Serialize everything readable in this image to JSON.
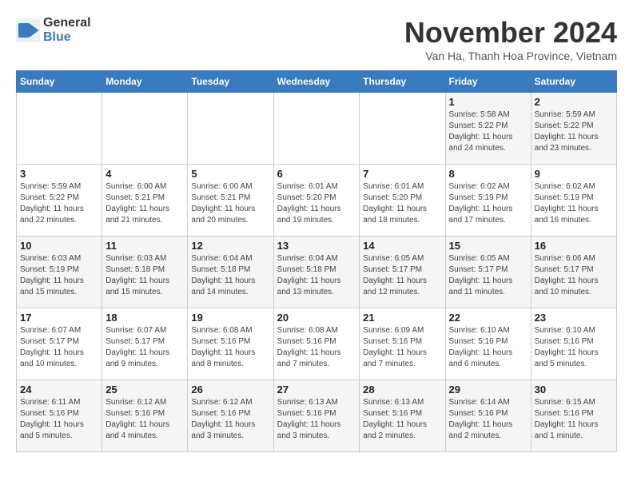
{
  "header": {
    "logo_line1": "General",
    "logo_line2": "Blue",
    "month_title": "November 2024",
    "location": "Van Ha, Thanh Hoa Province, Vietnam"
  },
  "weekdays": [
    "Sunday",
    "Monday",
    "Tuesday",
    "Wednesday",
    "Thursday",
    "Friday",
    "Saturday"
  ],
  "weeks": [
    {
      "cells": [
        {
          "day": "",
          "info": ""
        },
        {
          "day": "",
          "info": ""
        },
        {
          "day": "",
          "info": ""
        },
        {
          "day": "",
          "info": ""
        },
        {
          "day": "",
          "info": ""
        },
        {
          "day": "1",
          "info": "Sunrise: 5:58 AM\nSunset: 5:22 PM\nDaylight: 11 hours\nand 24 minutes."
        },
        {
          "day": "2",
          "info": "Sunrise: 5:59 AM\nSunset: 5:22 PM\nDaylight: 11 hours\nand 23 minutes."
        }
      ]
    },
    {
      "cells": [
        {
          "day": "3",
          "info": "Sunrise: 5:59 AM\nSunset: 5:22 PM\nDaylight: 11 hours\nand 22 minutes."
        },
        {
          "day": "4",
          "info": "Sunrise: 6:00 AM\nSunset: 5:21 PM\nDaylight: 11 hours\nand 21 minutes."
        },
        {
          "day": "5",
          "info": "Sunrise: 6:00 AM\nSunset: 5:21 PM\nDaylight: 11 hours\nand 20 minutes."
        },
        {
          "day": "6",
          "info": "Sunrise: 6:01 AM\nSunset: 5:20 PM\nDaylight: 11 hours\nand 19 minutes."
        },
        {
          "day": "7",
          "info": "Sunrise: 6:01 AM\nSunset: 5:20 PM\nDaylight: 11 hours\nand 18 minutes."
        },
        {
          "day": "8",
          "info": "Sunrise: 6:02 AM\nSunset: 5:19 PM\nDaylight: 11 hours\nand 17 minutes."
        },
        {
          "day": "9",
          "info": "Sunrise: 6:02 AM\nSunset: 5:19 PM\nDaylight: 11 hours\nand 16 minutes."
        }
      ]
    },
    {
      "cells": [
        {
          "day": "10",
          "info": "Sunrise: 6:03 AM\nSunset: 5:19 PM\nDaylight: 11 hours\nand 15 minutes."
        },
        {
          "day": "11",
          "info": "Sunrise: 6:03 AM\nSunset: 5:18 PM\nDaylight: 11 hours\nand 15 minutes."
        },
        {
          "day": "12",
          "info": "Sunrise: 6:04 AM\nSunset: 5:18 PM\nDaylight: 11 hours\nand 14 minutes."
        },
        {
          "day": "13",
          "info": "Sunrise: 6:04 AM\nSunset: 5:18 PM\nDaylight: 11 hours\nand 13 minutes."
        },
        {
          "day": "14",
          "info": "Sunrise: 6:05 AM\nSunset: 5:17 PM\nDaylight: 11 hours\nand 12 minutes."
        },
        {
          "day": "15",
          "info": "Sunrise: 6:05 AM\nSunset: 5:17 PM\nDaylight: 11 hours\nand 11 minutes."
        },
        {
          "day": "16",
          "info": "Sunrise: 6:06 AM\nSunset: 5:17 PM\nDaylight: 11 hours\nand 10 minutes."
        }
      ]
    },
    {
      "cells": [
        {
          "day": "17",
          "info": "Sunrise: 6:07 AM\nSunset: 5:17 PM\nDaylight: 11 hours\nand 10 minutes."
        },
        {
          "day": "18",
          "info": "Sunrise: 6:07 AM\nSunset: 5:17 PM\nDaylight: 11 hours\nand 9 minutes."
        },
        {
          "day": "19",
          "info": "Sunrise: 6:08 AM\nSunset: 5:16 PM\nDaylight: 11 hours\nand 8 minutes."
        },
        {
          "day": "20",
          "info": "Sunrise: 6:08 AM\nSunset: 5:16 PM\nDaylight: 11 hours\nand 7 minutes."
        },
        {
          "day": "21",
          "info": "Sunrise: 6:09 AM\nSunset: 5:16 PM\nDaylight: 11 hours\nand 7 minutes."
        },
        {
          "day": "22",
          "info": "Sunrise: 6:10 AM\nSunset: 5:16 PM\nDaylight: 11 hours\nand 6 minutes."
        },
        {
          "day": "23",
          "info": "Sunrise: 6:10 AM\nSunset: 5:16 PM\nDaylight: 11 hours\nand 5 minutes."
        }
      ]
    },
    {
      "cells": [
        {
          "day": "24",
          "info": "Sunrise: 6:11 AM\nSunset: 5:16 PM\nDaylight: 11 hours\nand 5 minutes."
        },
        {
          "day": "25",
          "info": "Sunrise: 6:12 AM\nSunset: 5:16 PM\nDaylight: 11 hours\nand 4 minutes."
        },
        {
          "day": "26",
          "info": "Sunrise: 6:12 AM\nSunset: 5:16 PM\nDaylight: 11 hours\nand 3 minutes."
        },
        {
          "day": "27",
          "info": "Sunrise: 6:13 AM\nSunset: 5:16 PM\nDaylight: 11 hours\nand 3 minutes."
        },
        {
          "day": "28",
          "info": "Sunrise: 6:13 AM\nSunset: 5:16 PM\nDaylight: 11 hours\nand 2 minutes."
        },
        {
          "day": "29",
          "info": "Sunrise: 6:14 AM\nSunset: 5:16 PM\nDaylight: 11 hours\nand 2 minutes."
        },
        {
          "day": "30",
          "info": "Sunrise: 6:15 AM\nSunset: 5:16 PM\nDaylight: 11 hours\nand 1 minute."
        }
      ]
    }
  ]
}
